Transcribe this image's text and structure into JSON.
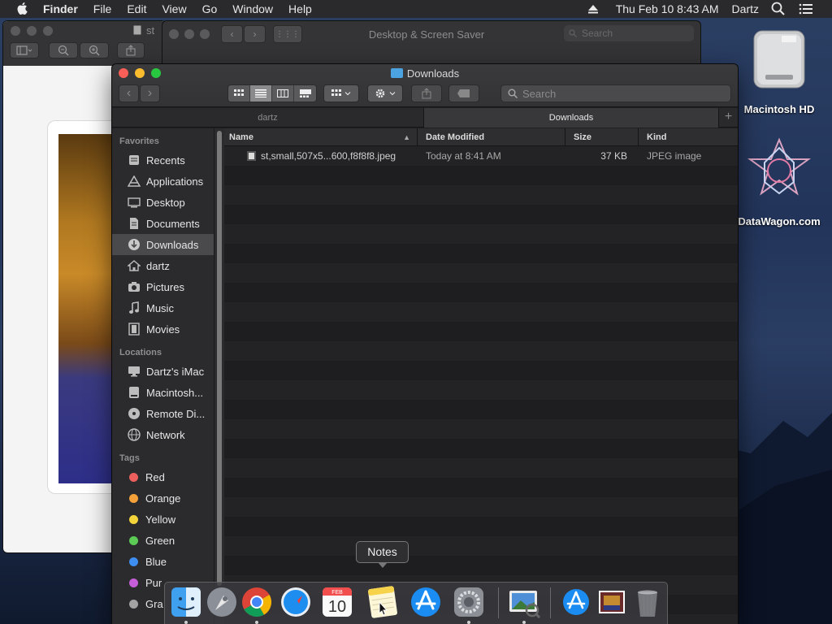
{
  "menubar": {
    "app": "Finder",
    "items": [
      "File",
      "Edit",
      "View",
      "Go",
      "Window",
      "Help"
    ],
    "clock": "Thu Feb 10  8:43 AM",
    "user": "Dartz"
  },
  "bg_windows": {
    "preview_title": "st",
    "system_prefs_title": "Desktop & Screen Saver",
    "system_prefs_search": "Search"
  },
  "finder": {
    "title": "Downloads",
    "search_placeholder": "Search",
    "tabs": [
      "dartz",
      "Downloads"
    ],
    "columns": {
      "name": "Name",
      "date": "Date Modified",
      "size": "Size",
      "kind": "Kind"
    },
    "files": [
      {
        "name": "st,small,507x5...600,f8f8f8.jpeg",
        "date": "Today at 8:41 AM",
        "size": "37 KB",
        "kind": "JPEG image"
      }
    ]
  },
  "sidebar": {
    "favorites_label": "Favorites",
    "favorites": [
      "Recents",
      "Applications",
      "Desktop",
      "Documents",
      "Downloads",
      "dartz",
      "Pictures",
      "Music",
      "Movies"
    ],
    "locations_label": "Locations",
    "locations": [
      "Dartz's iMac",
      "Macintosh...",
      "Remote Di...",
      "Network"
    ],
    "tags_label": "Tags",
    "tags": [
      {
        "name": "Red",
        "color": "#ec5f5c"
      },
      {
        "name": "Orange",
        "color": "#f5a13a"
      },
      {
        "name": "Yellow",
        "color": "#f3d43b"
      },
      {
        "name": "Green",
        "color": "#5ccb55"
      },
      {
        "name": "Blue",
        "color": "#3d8ef0"
      },
      {
        "name": "Pur",
        "color": "#c55ed8"
      },
      {
        "name": "Gra",
        "color": "#a3a3a3"
      }
    ]
  },
  "desktop": {
    "icons": [
      "Macintosh HD",
      "DataWagon.com"
    ]
  },
  "dock": {
    "tooltip": "Notes",
    "calendar_month": "FEB",
    "calendar_day": "10"
  }
}
